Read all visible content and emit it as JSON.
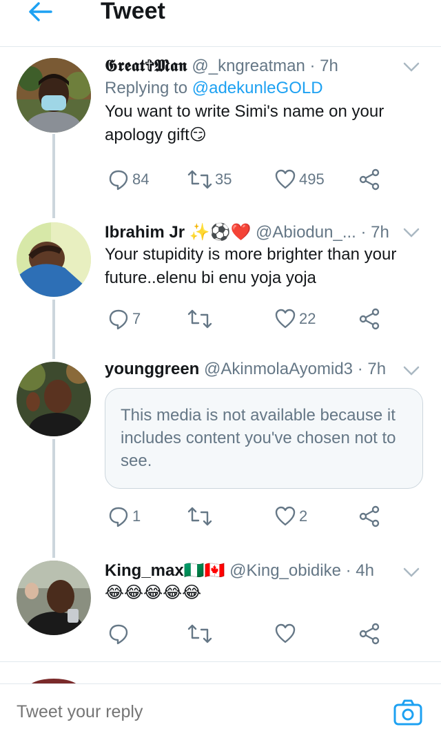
{
  "header": {
    "title": "Tweet"
  },
  "tweets": [
    {
      "name": "𝕲𝖗𝖊𝖆𝖙✞𝕸𝖆𝖓",
      "handle": "@_kngreatman",
      "time": "· 7h",
      "replying_label": "Replying to",
      "replying_handle": "@adekunleGOLD",
      "text": "You want to write Simi's name on your apology gift😏",
      "replies": "84",
      "retweets": "35",
      "likes": "495"
    },
    {
      "name": "Ibrahim Jr ✨⚽❤️",
      "handle": "@Abiodun_...",
      "time": "· 7h",
      "text": "Your stupidity is more brighter than your future..elenu bi enu yoja yoja",
      "replies": "7",
      "retweets": "",
      "likes": "22"
    },
    {
      "name": "younggreen",
      "handle": "@AkinmolaAyomid3",
      "time": "· 7h",
      "media_notice": "This media is not available because it includes content you've chosen not to see.",
      "replies": "1",
      "retweets": "",
      "likes": "2"
    },
    {
      "name": "King_max🇳🇬🇨🇦",
      "handle": "@King_obidike",
      "time": "· 4h",
      "text": "😂😂😂😂😂",
      "replies": "",
      "retweets": "",
      "likes": ""
    }
  ],
  "reply_bar": {
    "placeholder": "Tweet your reply"
  },
  "colors": {
    "accent": "#1da1f2",
    "muted": "#657786",
    "border": "#e1e8ed"
  }
}
